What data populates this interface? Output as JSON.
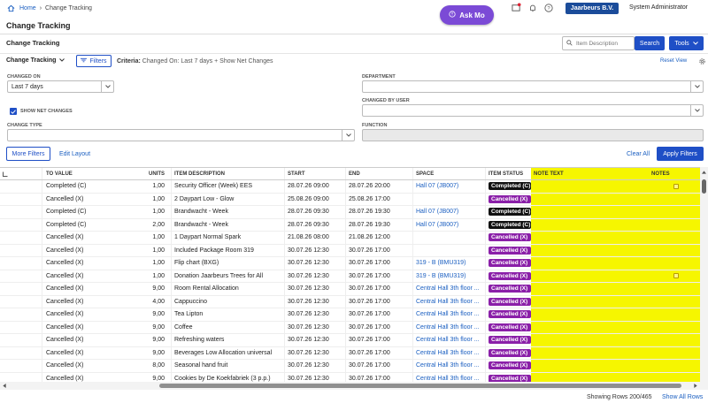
{
  "breadcrumb": {
    "home": "Home",
    "current": "Change Tracking"
  },
  "ask_mo": "Ask Mo",
  "org": "Jaarbeurs B.V.",
  "user": "System Administrator",
  "page_title": "Change Tracking",
  "subtitle": "Change Tracking",
  "search": {
    "placeholder": "Item Description",
    "button": "Search"
  },
  "tools": "Tools",
  "view": "Change Tracking",
  "filters_btn": "Filters",
  "criteria_label": "Criteria:",
  "criteria_text": "Changed On: Last 7 days + Show Net Changes",
  "reset_view": "Reset View",
  "filters": {
    "changed_on_label": "CHANGED ON",
    "changed_on_value": "Last 7 days",
    "department_label": "DEPARTMENT",
    "department_value": "",
    "show_net_label": "SHOW NET CHANGES",
    "changed_by_label": "CHANGED BY USER",
    "changed_by_value": "",
    "change_type_label": "CHANGE TYPE",
    "change_type_value": "",
    "function_label": "FUNCTION",
    "function_value": ""
  },
  "more_filters": "More Filters",
  "edit_layout": "Edit Layout",
  "clear_all": "Clear All",
  "apply_filters": "Apply Filters",
  "columns": {
    "to_value": "TO VALUE",
    "units": "UNITS",
    "desc": "ITEM DESCRIPTION",
    "start": "START",
    "end": "END",
    "space": "SPACE",
    "status": "ITEM STATUS",
    "note_text": "NOTE TEXT",
    "notes": "NOTES"
  },
  "rows": [
    {
      "to_value": "Completed (C)",
      "units": "1,00",
      "desc": "Security Officer (Week) EES",
      "start": "28.07.26 09:00",
      "end": "28.07.26 20:00",
      "space": "Hall 07 (JB007)",
      "status": "Completed (C)",
      "status_type": "completed",
      "note": true
    },
    {
      "to_value": "Cancelled (X)",
      "units": "1,00",
      "desc": "2 Daypart Low - Glow",
      "start": "25.08.26 09:00",
      "end": "25.08.26 17:00",
      "space": "",
      "status": "Cancelled (X)",
      "status_type": "cancelled",
      "note": false
    },
    {
      "to_value": "Completed (C)",
      "units": "1,00",
      "desc": "Brandwacht - Week",
      "start": "28.07.26 09:30",
      "end": "28.07.26 19:30",
      "space": "Hall 07 (JB007)",
      "status": "Completed (C)",
      "status_type": "completed",
      "note": false
    },
    {
      "to_value": "Completed (C)",
      "units": "2,00",
      "desc": "Brandwacht - Week",
      "start": "28.07.26 09:30",
      "end": "28.07.26 19:30",
      "space": "Hall 07 (JB007)",
      "status": "Completed (C)",
      "status_type": "completed",
      "note": false
    },
    {
      "to_value": "Cancelled (X)",
      "units": "1,00",
      "desc": "1 Daypart Normal Spark",
      "start": "21.08.26 08:00",
      "end": "21.08.26 12:00",
      "space": "",
      "status": "Cancelled (X)",
      "status_type": "cancelled",
      "note": false
    },
    {
      "to_value": "Cancelled (X)",
      "units": "1,00",
      "desc": "Included Package Room 319",
      "start": "30.07.26 12:30",
      "end": "30.07.26 17:00",
      "space": "",
      "status": "Cancelled (X)",
      "status_type": "cancelled",
      "note": false
    },
    {
      "to_value": "Cancelled (X)",
      "units": "1,00",
      "desc": "Flip chart (BXG)",
      "start": "30.07.26 12:30",
      "end": "30.07.26 17:00",
      "space": "319 - B (BMU319)",
      "status": "Cancelled (X)",
      "status_type": "cancelled",
      "note": false
    },
    {
      "to_value": "Cancelled (X)",
      "units": "1,00",
      "desc": "Donation Jaarbeurs Trees for All",
      "start": "30.07.26 12:30",
      "end": "30.07.26 17:00",
      "space": "319 - B (BMU319)",
      "status": "Cancelled (X)",
      "status_type": "cancelled",
      "note": true
    },
    {
      "to_value": "Cancelled (X)",
      "units": "9,00",
      "desc": "Room Rental Allocation",
      "start": "30.07.26 12:30",
      "end": "30.07.26 17:00",
      "space": "Central Hall 3th floor ...",
      "status": "Cancelled (X)",
      "status_type": "cancelled",
      "note": false
    },
    {
      "to_value": "Cancelled (X)",
      "units": "4,00",
      "desc": "Cappuccino",
      "start": "30.07.26 12:30",
      "end": "30.07.26 17:00",
      "space": "Central Hall 3th floor ...",
      "status": "Cancelled (X)",
      "status_type": "cancelled",
      "note": false
    },
    {
      "to_value": "Cancelled (X)",
      "units": "9,00",
      "desc": "Tea Lipton",
      "start": "30.07.26 12:30",
      "end": "30.07.26 17:00",
      "space": "Central Hall 3th floor ...",
      "status": "Cancelled (X)",
      "status_type": "cancelled",
      "note": false
    },
    {
      "to_value": "Cancelled (X)",
      "units": "9,00",
      "desc": "Coffee",
      "start": "30.07.26 12:30",
      "end": "30.07.26 17:00",
      "space": "Central Hall 3th floor ...",
      "status": "Cancelled (X)",
      "status_type": "cancelled",
      "note": false
    },
    {
      "to_value": "Cancelled (X)",
      "units": "9,00",
      "desc": "Refreshing waters",
      "start": "30.07.26 12:30",
      "end": "30.07.26 17:00",
      "space": "Central Hall 3th floor ...",
      "status": "Cancelled (X)",
      "status_type": "cancelled",
      "note": false
    },
    {
      "to_value": "Cancelled (X)",
      "units": "9,00",
      "desc": "Beverages Low Allocation universal",
      "start": "30.07.26 12:30",
      "end": "30.07.26 17:00",
      "space": "Central Hall 3th floor ...",
      "status": "Cancelled (X)",
      "status_type": "cancelled",
      "note": false
    },
    {
      "to_value": "Cancelled (X)",
      "units": "8,00",
      "desc": "Seasonal hand fruit",
      "start": "30.07.26 12:30",
      "end": "30.07.26 17:00",
      "space": "Central Hall 3th floor ...",
      "status": "Cancelled (X)",
      "status_type": "cancelled",
      "note": false
    },
    {
      "to_value": "Cancelled (X)",
      "units": "9,00",
      "desc": "Cookies by De Koekfabriek (3 p.p.)",
      "start": "30.07.26 12:30",
      "end": "30.07.26 17:00",
      "space": "Central Hall 3th floor ...",
      "status": "Cancelled (X)",
      "status_type": "cancelled",
      "note": false
    }
  ],
  "footer": {
    "rows": "Showing Rows 200/465",
    "show_all": "Show All Rows"
  }
}
